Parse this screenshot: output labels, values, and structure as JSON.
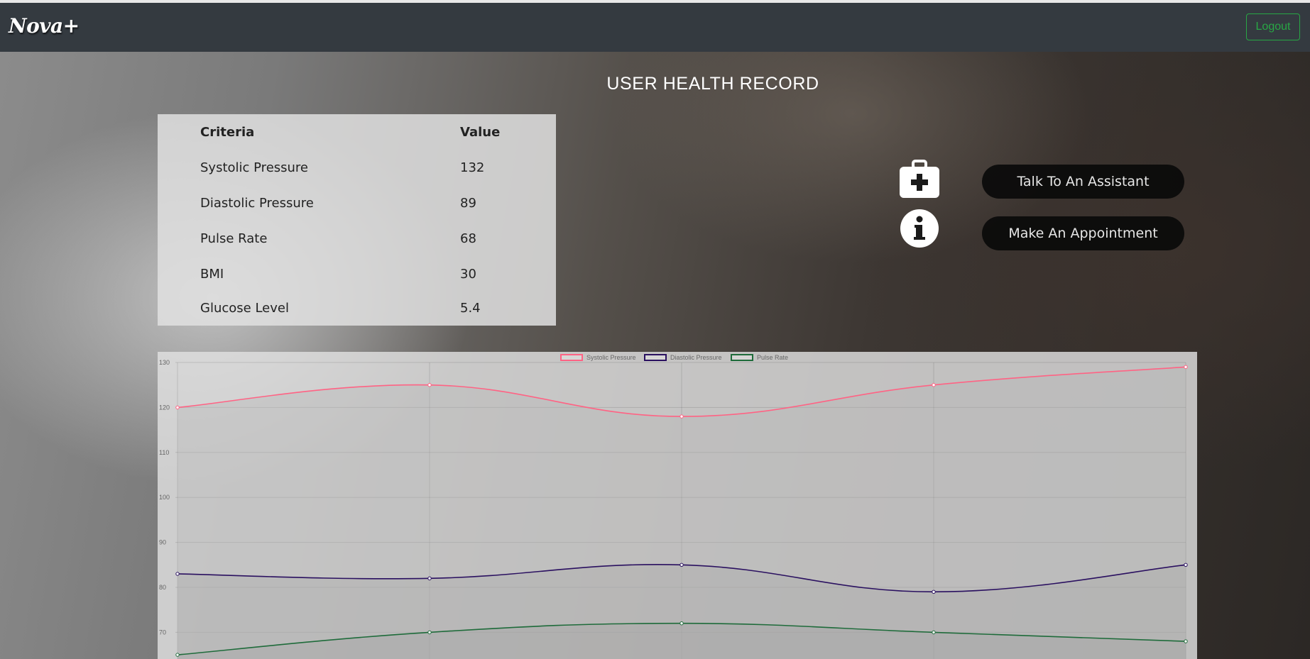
{
  "app": {
    "brand": "Nova+",
    "logout_label": "Logout",
    "logout_color": "#28a745"
  },
  "page": {
    "title": "USER HEALTH RECORD"
  },
  "record_table": {
    "headers": [
      "Criteria",
      "Value"
    ],
    "rows": [
      {
        "criteria": "Systolic Pressure",
        "value": "132"
      },
      {
        "criteria": "Diastolic Pressure",
        "value": "89"
      },
      {
        "criteria": "Pulse Rate",
        "value": "68"
      },
      {
        "criteria": "BMI",
        "value": "30"
      },
      {
        "criteria": "Glucose Level",
        "value": "5.4"
      }
    ]
  },
  "actions": {
    "assistant": {
      "icon": "medkit-icon",
      "label": "Talk To An Assistant"
    },
    "appointment": {
      "icon": "info-circle-icon",
      "label": "Make An Appointment"
    }
  },
  "chart_data": {
    "type": "line",
    "x": [
      0,
      1,
      2,
      3,
      4
    ],
    "ylim": [
      66,
      130
    ],
    "yticks": [
      70,
      80,
      90,
      100,
      110,
      120,
      130
    ],
    "grid": true,
    "legend": "top-center",
    "series": [
      {
        "name": "Systolic Pressure",
        "values": [
          120,
          125,
          118,
          125,
          129
        ],
        "color": "#ff6384",
        "fill": "rgba(180,180,180,0.35)"
      },
      {
        "name": "Diastolic Pressure",
        "values": [
          83,
          82,
          85,
          79,
          85
        ],
        "color": "#2a1060",
        "fill": "rgba(170,170,170,0.35)"
      },
      {
        "name": "Pulse Rate",
        "values": [
          65,
          70,
          72,
          70,
          68
        ],
        "color": "#1e6b3a",
        "fill": "rgba(160,160,160,0.35)"
      }
    ]
  }
}
